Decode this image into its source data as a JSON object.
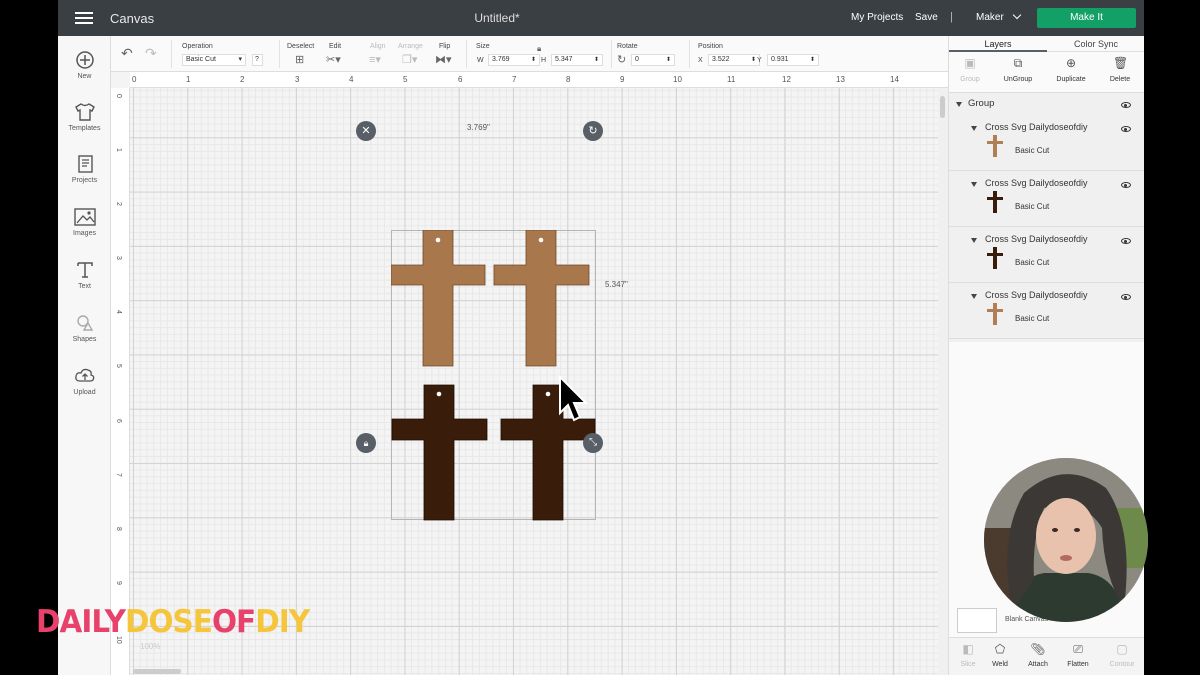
{
  "topbar": {
    "app_title": "Canvas",
    "doc_title": "Untitled*",
    "my_projects": "My Projects",
    "save": "Save",
    "separator": "|",
    "machine": "Maker",
    "make_it": "Make It",
    "make_it_color": "#13a067"
  },
  "left_tools": [
    {
      "label": "New",
      "icon": "plus-circle-icon"
    },
    {
      "label": "Templates",
      "icon": "shirt-icon"
    },
    {
      "label": "Projects",
      "icon": "notebook-icon"
    },
    {
      "label": "Images",
      "icon": "image-icon"
    },
    {
      "label": "Text",
      "icon": "text-icon"
    },
    {
      "label": "Shapes",
      "icon": "shapes-icon"
    },
    {
      "label": "Upload",
      "icon": "upload-cloud-icon"
    }
  ],
  "editbar": {
    "operation_label": "Operation",
    "operation_value": "Basic Cut",
    "help": "?",
    "deselect_label": "Deselect",
    "edit_label": "Edit",
    "align_label": "Align",
    "arrange_label": "Arrange",
    "flip_label": "Flip",
    "size_label": "Size",
    "w_label": "W",
    "w_value": "3.769",
    "h_label": "H",
    "h_value": "5.347",
    "rotate_label": "Rotate",
    "rotate_value": "0",
    "position_label": "Position",
    "x_label": "X",
    "x_value": "3.522",
    "y_label": "Y",
    "y_value": "0.931"
  },
  "ruler": {
    "h_numbers": [
      "0",
      "1",
      "2",
      "3",
      "4",
      "5",
      "6",
      "7",
      "8",
      "9",
      "10",
      "11",
      "12",
      "13",
      "14"
    ],
    "v_numbers": [
      "0",
      "1",
      "2",
      "3",
      "4",
      "5",
      "6",
      "7",
      "8",
      "9",
      "10"
    ]
  },
  "canvas": {
    "width_label": "3.769\"",
    "height_label": "5.347\"",
    "zoom": "100%",
    "light_cross_color": "#a8774c",
    "dark_cross_color": "#3a1c0a"
  },
  "panel": {
    "tab_layers": "Layers",
    "tab_color_sync": "Color Sync",
    "actions": [
      "Group",
      "UnGroup",
      "Duplicate",
      "Delete"
    ],
    "group_label": "Group",
    "layers": [
      {
        "name": "Cross Svg Dailydoseofdiy",
        "operation": "Basic Cut",
        "color": "#b07f54"
      },
      {
        "name": "Cross Svg Dailydoseofdiy",
        "operation": "Basic Cut",
        "color": "#3a1c0a"
      },
      {
        "name": "Cross Svg Dailydoseofdiy",
        "operation": "Basic Cut",
        "color": "#3a1c0a"
      },
      {
        "name": "Cross Svg Dailydoseofdiy",
        "operation": "Basic Cut",
        "color": "#b07f54"
      }
    ],
    "blank_canvas": "Blank Canvas",
    "bottom_actions": [
      "Slice",
      "Weld",
      "Attach",
      "Flatten",
      "Contour"
    ]
  },
  "logo": {
    "part1": "DAILY",
    "part2": "DOSE",
    "part3": "OF",
    "part4": "DIY"
  }
}
